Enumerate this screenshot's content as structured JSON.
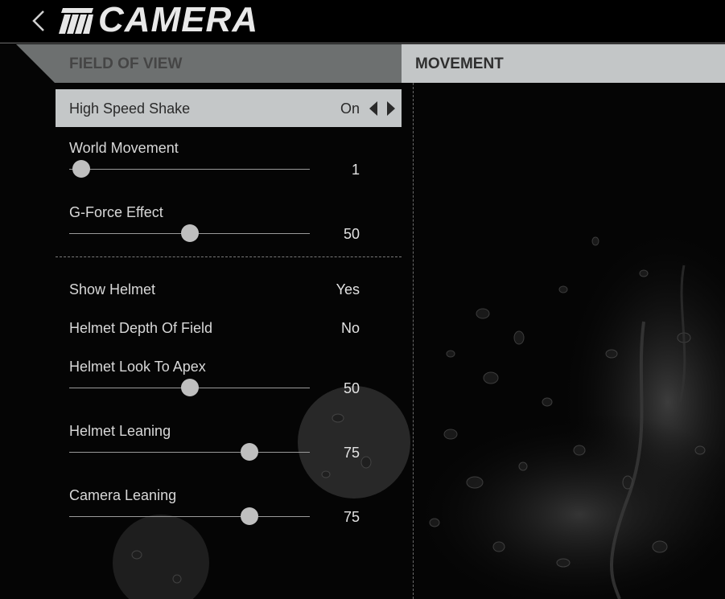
{
  "header": {
    "title": "CAMERA"
  },
  "tabs": {
    "field_of_view": "FIELD OF VIEW",
    "movement": "MOVEMENT"
  },
  "settings": {
    "high_speed_shake": {
      "label": "High Speed Shake",
      "value": "On"
    },
    "world_movement": {
      "label": "World Movement",
      "value": "1",
      "level": 0.05
    },
    "g_force_effect": {
      "label": "G-Force Effect",
      "value": "50",
      "level": 0.5
    },
    "show_helmet": {
      "label": "Show Helmet",
      "value": "Yes"
    },
    "helmet_depth_of_field": {
      "label": "Helmet Depth Of Field",
      "value": "No"
    },
    "helmet_look_to_apex": {
      "label": "Helmet Look To Apex",
      "value": "50",
      "level": 0.5
    },
    "helmet_leaning": {
      "label": "Helmet Leaning",
      "value": "75",
      "level": 0.75
    },
    "camera_leaning": {
      "label": "Camera Leaning",
      "value": "75",
      "level": 0.75
    }
  },
  "colors": {
    "selected_row": "#c4c7c8",
    "inactive_tab": "#6d7070",
    "active_tab": "#c3c6c7",
    "knob": "#bfbfbf"
  },
  "icons": {
    "back": "chevron-left-icon",
    "logo": "brand-stripes-logo",
    "prev": "triangle-left-icon",
    "next": "triangle-right-icon"
  }
}
